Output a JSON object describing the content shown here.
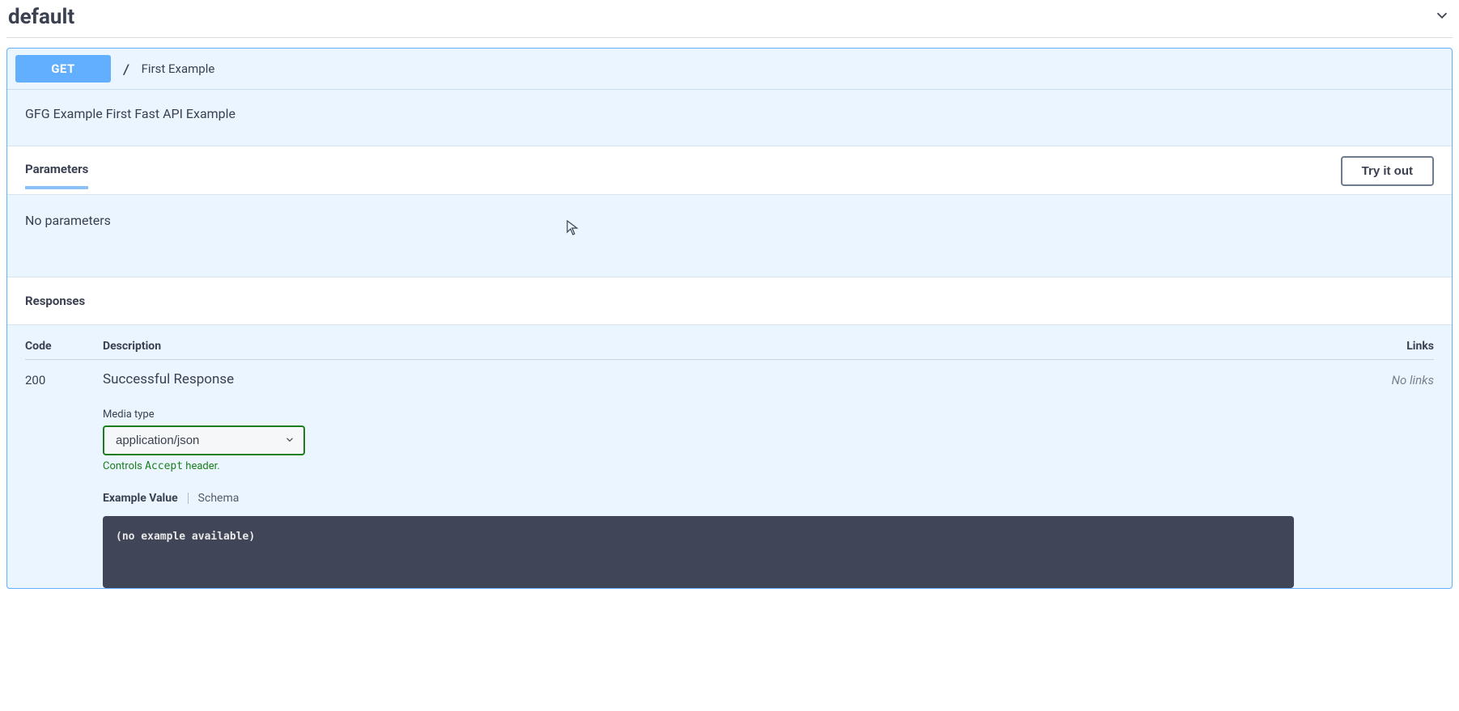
{
  "tag": {
    "name": "default"
  },
  "endpoint": {
    "method": "GET",
    "path": "/",
    "summary": "First Example",
    "description": "GFG Example First Fast API Example"
  },
  "sections": {
    "parameters_label": "Parameters",
    "try_it_out": "Try it out",
    "no_parameters": "No parameters",
    "responses_label": "Responses"
  },
  "response_headers": {
    "code": "Code",
    "description": "Description",
    "links": "Links"
  },
  "response": {
    "code": "200",
    "description": "Successful Response",
    "links_text": "No links",
    "media_type_label": "Media type",
    "media_type_value": "application/json",
    "controls_prefix": "Controls ",
    "controls_code": "Accept",
    "controls_suffix": " header.",
    "tab_example": "Example Value",
    "tab_schema": "Schema",
    "example_body": "(no example available)"
  }
}
